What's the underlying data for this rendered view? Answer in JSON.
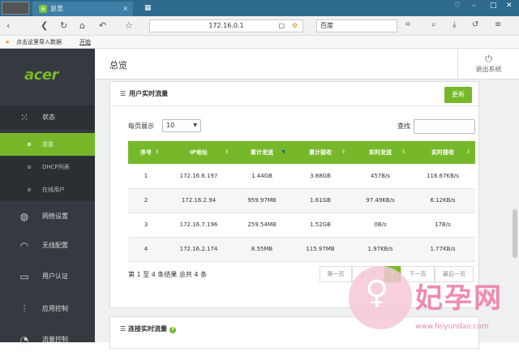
{
  "browser": {
    "tab_title": "总览",
    "url": "172.16.0.1",
    "search_engine": "百度",
    "bookmark_import": "点击这里导入数据",
    "bookmark_start": "开始"
  },
  "sidebar": {
    "brand": "acer",
    "items": [
      {
        "label": "状态",
        "icon": "grid-dots-icon"
      },
      {
        "label": "网络设置",
        "icon": "globe-icon"
      },
      {
        "label": "无线配置",
        "icon": "wifi-icon"
      },
      {
        "label": "用户认证",
        "icon": "id-card-icon"
      },
      {
        "label": "应用控制",
        "icon": "sliders-icon"
      },
      {
        "label": "流量控制",
        "icon": "speed-icon"
      }
    ],
    "subitems": [
      {
        "label": "总览"
      },
      {
        "label": "DHCP列表"
      },
      {
        "label": "在线用户"
      }
    ]
  },
  "header": {
    "title": "总览",
    "logout": "退出系统"
  },
  "traffic": {
    "title": "用户实时流量",
    "refresh": "更新",
    "page_size_label": "每页展示",
    "page_size": "10",
    "search_label": "查找",
    "columns": [
      "序号",
      "IP地址",
      "累计发送",
      "累计接收",
      "实时发送",
      "实时接收"
    ],
    "rows": [
      [
        "1",
        "172.16.6.197",
        "1.44GB",
        "3.88GB",
        "457B/s",
        "116.67KB/s"
      ],
      [
        "2",
        "172.16.2.94",
        "959.97MB",
        "1.61GB",
        "97.49KB/s",
        "6.12KB/s"
      ],
      [
        "3",
        "172.16.7.196",
        "259.54MB",
        "1.52GB",
        "0B/s",
        "17B/s"
      ],
      [
        "4",
        "172.16.2.174",
        "8.55MB",
        "115.97MB",
        "1.97KB/s",
        "1.77KB/s"
      ]
    ],
    "summary": "第 1 至 4 条结果  总共 4 条",
    "pager": {
      "first": "第一页",
      "prev": "上一页",
      "current": "1",
      "next": "下一页",
      "last": "最后一页"
    }
  },
  "connection": {
    "title": "连接实时流量"
  },
  "watermark": {
    "text": "妃孕网",
    "url": "www.feiyundao.com"
  },
  "colors": {
    "accent": "#76b82a",
    "sidebar": "#343a3f",
    "browser": "#2d6a8e"
  }
}
